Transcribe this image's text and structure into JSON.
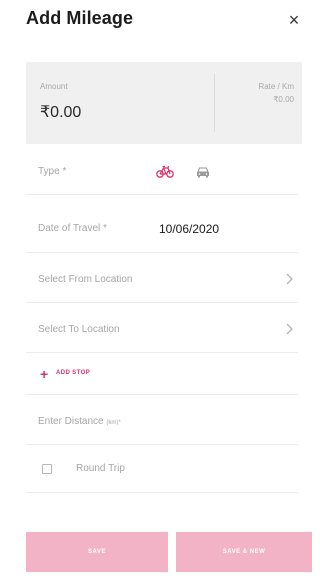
{
  "header": {
    "title": "Add Mileage",
    "close_glyph": "×"
  },
  "summary": {
    "amount_label": "Amount",
    "amount_value": "₹0.00",
    "rate_label": "Rate / Km",
    "rate_value": "₹0.00"
  },
  "form": {
    "type_label": "Type *",
    "type_options": [
      "bicycle-icon",
      "car-icon"
    ],
    "selected_type": "bicycle-icon",
    "date_label": "Date of Travel *",
    "date_value": "10/06/2020",
    "from_location_label": "Select From Location",
    "to_location_label": "Select To Location",
    "add_stop_label": "ADD STOP",
    "distance_label": "Enter Distance",
    "distance_unit": "(km)*",
    "round_trip_label": "Round Trip",
    "round_trip_checked": false
  },
  "actions": {
    "save_label": "SAVE",
    "save_new_label": "SAVE & NEW"
  },
  "colors": {
    "accent": "#d8336e",
    "button_disabled": "#f2b3c6",
    "card_background": "#f0f0f0"
  }
}
